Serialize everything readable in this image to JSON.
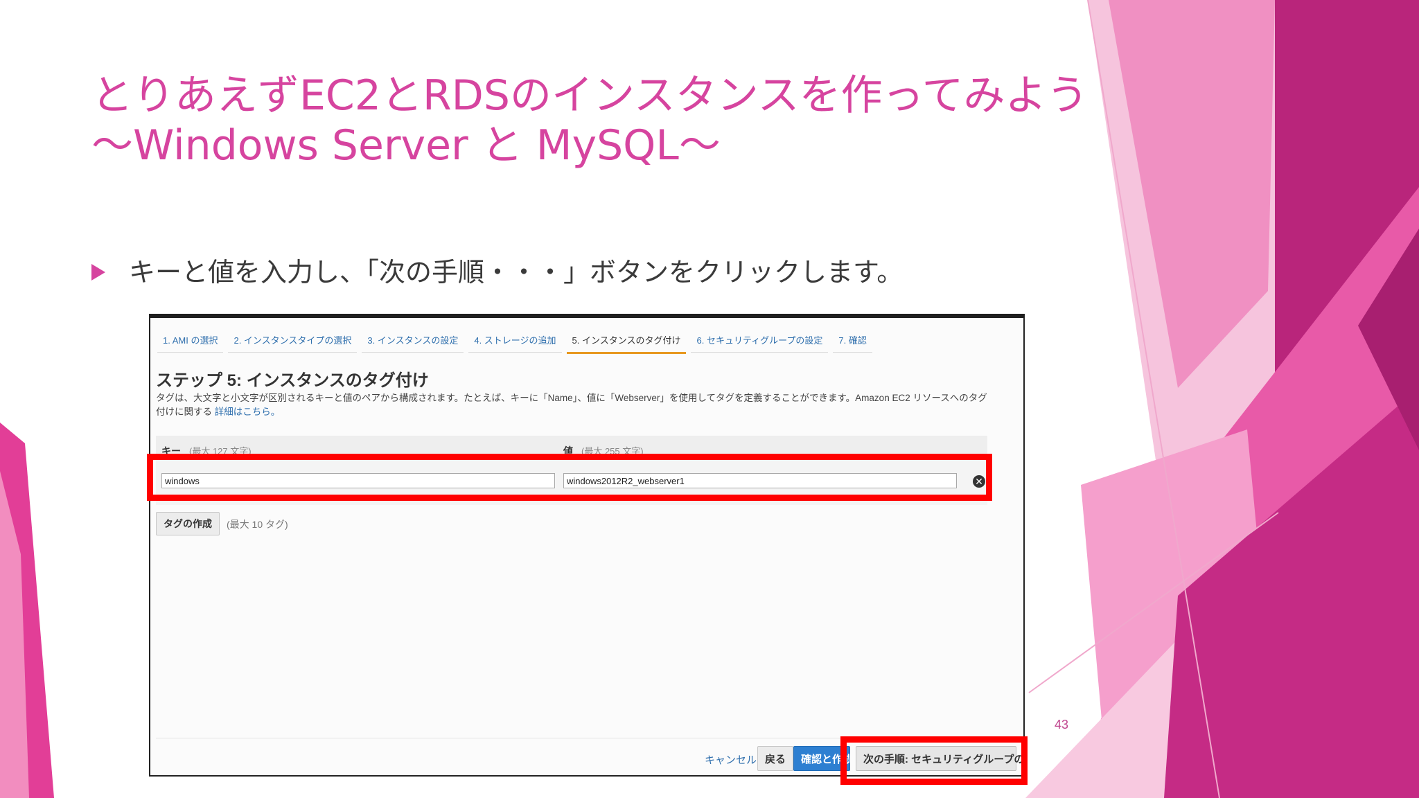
{
  "slide": {
    "title_line1": "とりあえずEC2とRDSのインスタンスを作ってみよう",
    "title_line2": "～Windows Server と MySQL～",
    "bullet": "キーと値を入力し、「次の手順・・・」ボタンをクリックします。",
    "page_number": "43",
    "colors": {
      "accent": "#d6449f",
      "highlight": "#ff0000",
      "link": "#2f6fad",
      "primary_button": "#2d7fd1",
      "active_tab": "#e79820"
    }
  },
  "wizard": {
    "tabs": [
      {
        "label": "1. AMI の選択"
      },
      {
        "label": "2. インスタンスタイプの選択"
      },
      {
        "label": "3. インスタンスの設定"
      },
      {
        "label": "4. ストレージの追加"
      },
      {
        "label": "5. インスタンスのタグ付け",
        "active": true
      },
      {
        "label": "6. セキュリティグループの設定"
      },
      {
        "label": "7. 確認"
      }
    ],
    "step_title": "ステップ 5: インスタンスのタグ付け",
    "description": "タグは、大文字と小文字が区別されるキーと値のペアから構成されます。たとえば、キーに「Name」、値に「Webserver」を使用してタグを定義することができます。Amazon EC2 リソースへのタグ付けに関する",
    "description_link": "詳細はこちら。",
    "table": {
      "key_header": "キー",
      "key_hint": "(最大 127 文字)",
      "value_header": "値",
      "value_hint": "(最大 255 文字)",
      "rows": [
        {
          "key": "windows",
          "value": "windows2012R2_webserver1"
        }
      ],
      "remove_icon": "close-circle-icon"
    },
    "add_tag_button": "タグの作成",
    "max_tags": "(最大 10 タグ)",
    "footer": {
      "cancel": "キャンセル",
      "back": "戻る",
      "review_launch": "確認と作成",
      "next": "次の手順: セキュリティグループの設定"
    }
  }
}
